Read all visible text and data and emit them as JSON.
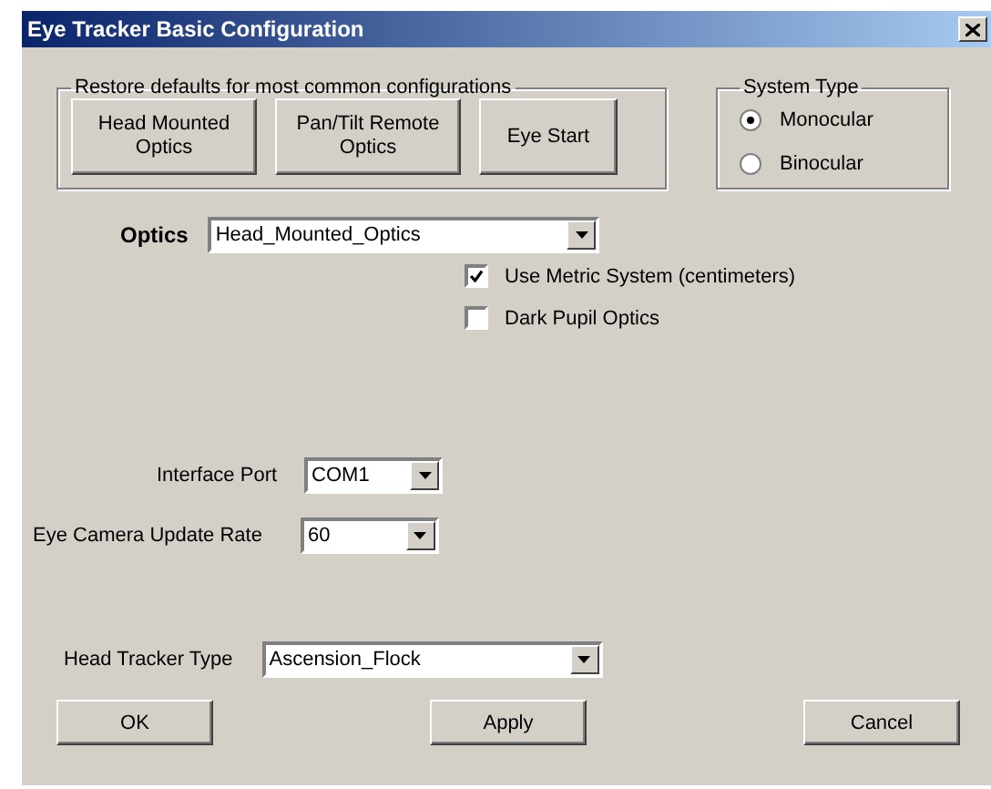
{
  "window": {
    "title": "Eye Tracker Basic Configuration"
  },
  "restore_defaults": {
    "legend": "Restore defaults for most common configurations",
    "buttons": [
      "Head Mounted Optics",
      "Pan/Tilt Remote Optics",
      "Eye Start"
    ]
  },
  "system_type": {
    "legend": "System Type",
    "options": [
      {
        "label": "Monocular",
        "selected": true
      },
      {
        "label": "Binocular",
        "selected": false
      }
    ]
  },
  "optics": {
    "label": "Optics",
    "value": "Head_Mounted_Optics"
  },
  "checkboxes": [
    {
      "label": "Use Metric System (centimeters)",
      "checked": true
    },
    {
      "label": "Dark Pupil Optics",
      "checked": false
    }
  ],
  "interface_port": {
    "label": "Interface Port",
    "value": "COM1"
  },
  "camera_update_rate": {
    "label": "Eye Camera Update Rate",
    "value": "60"
  },
  "head_tracker_type": {
    "label": "Head Tracker Type",
    "value": "Ascension_Flock"
  },
  "buttons": [
    "OK",
    "Apply",
    "Cancel"
  ]
}
